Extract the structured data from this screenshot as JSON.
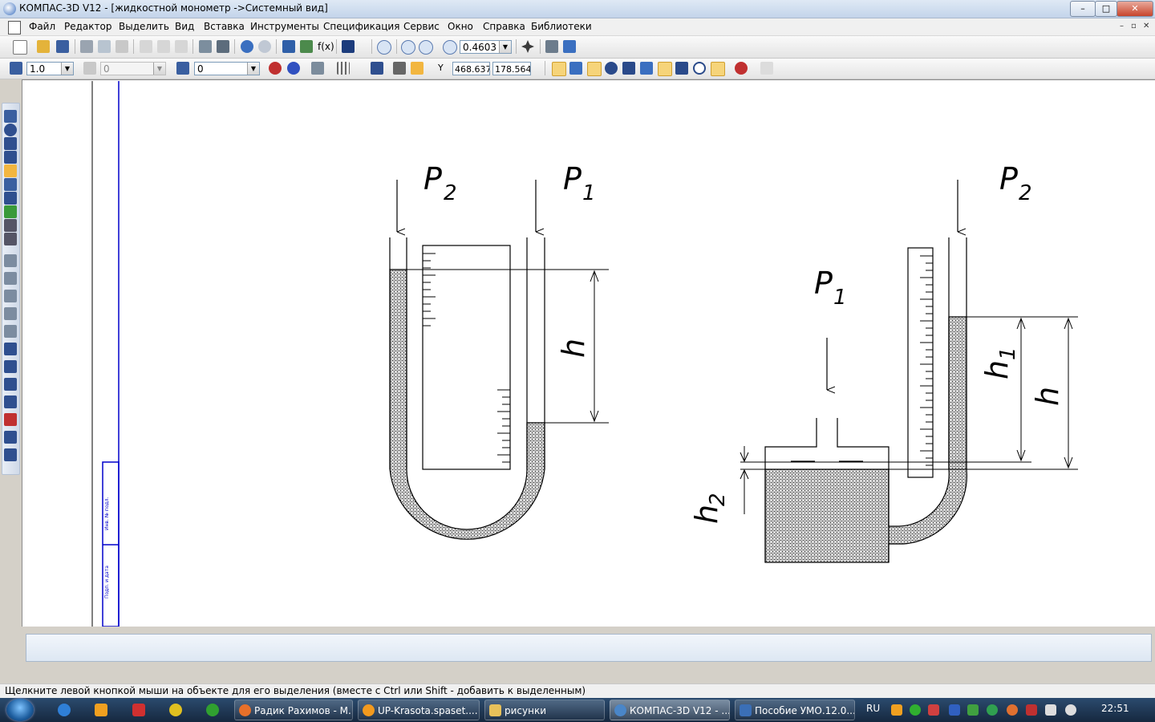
{
  "window": {
    "title": "КОМПАС-3D V12 - [жидкостной монометр ->Системный вид]",
    "minimize": "–",
    "maximize": "□",
    "close": "✕"
  },
  "menu": {
    "items": [
      "Файл",
      "Редактор",
      "Выделить",
      "Вид",
      "Вставка",
      "Инструменты",
      "Спецификация",
      "Сервис",
      "Окно",
      "Справка",
      "Библиотеки"
    ],
    "doc_controls": [
      "–",
      "▫",
      "✕"
    ]
  },
  "toolbar1": {
    "zoom_value": "0.4603",
    "fx_label": "f(x)"
  },
  "toolbar2": {
    "scale_value": "1.0",
    "layer_value": "0",
    "style_value": "0",
    "coord_x": "468.637",
    "coord_y": "178.564",
    "y_label": "Y"
  },
  "drawing": {
    "labels": {
      "p2_left": "P",
      "p2_left_sub": "2",
      "p1_left": "P",
      "p1_left_sub": "1",
      "h_left": "h",
      "p2_right": "P",
      "p2_right_sub": "2",
      "p1_right": "P",
      "p1_right_sub": "1",
      "h1": "h",
      "h1_sub": "1",
      "h_right": "h",
      "h2": "h",
      "h2_sub": "2"
    }
  },
  "status": {
    "hint": "Щелкните левой кнопкой мыши на объекте для его выделения (вместе с Ctrl или Shift - добавить к выделенным)"
  },
  "taskbar": {
    "tasks": [
      {
        "label": "Радик Рахимов - М...",
        "color": "#e8702a"
      },
      {
        "label": "UP-Krasota.spaset....",
        "color": "#f39a1e"
      },
      {
        "label": "рисунки",
        "color": "#e8c15a"
      },
      {
        "label": "КОМПАС-3D V12 - ...",
        "color": "#4a86c8"
      },
      {
        "label": "Пособие УМО.12.0...",
        "color": "#3b6fb6"
      }
    ],
    "lang": "RU",
    "clock": "22:51"
  },
  "colors": {
    "title_bg": "#c3d4ea",
    "canvas_bg": "#ffffff",
    "frame_blue": "#0000cc",
    "taskbar_bg": "#1c3250"
  }
}
